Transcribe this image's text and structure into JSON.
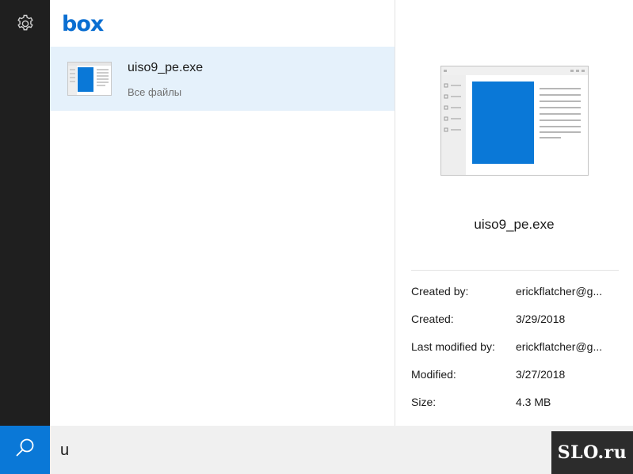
{
  "search": {
    "query": "u"
  },
  "results": {
    "logo": "box",
    "items": [
      {
        "title": "uiso9_pe.exe",
        "location": "Все файлы"
      }
    ]
  },
  "preview": {
    "title": "uiso9_pe.exe",
    "fields": [
      {
        "label": "Created by:",
        "value": "erickflatcher@g..."
      },
      {
        "label": "Created:",
        "value": "3/29/2018"
      },
      {
        "label": "Last modified by:",
        "value": "erickflatcher@g..."
      },
      {
        "label": "Modified:",
        "value": "3/27/2018"
      },
      {
        "label": "Size:",
        "value": "4.3 MB"
      }
    ]
  },
  "watermark": {
    "text": "SLO.ru"
  },
  "icons": {
    "settings": "gear-icon",
    "search": "search-icon",
    "file": "file-thumbnail"
  },
  "colors": {
    "accent": "#0a78d7",
    "rail": "#1f1f1f",
    "selection": "#e5f1fb",
    "logo": "#0a6ed1"
  }
}
